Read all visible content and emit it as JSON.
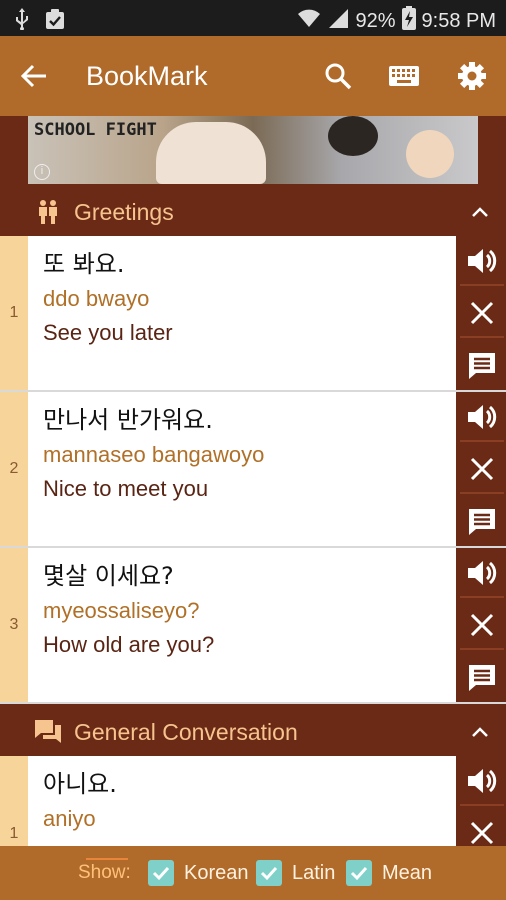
{
  "status_bar": {
    "battery": "92%",
    "time": "9:58 PM"
  },
  "app_bar": {
    "title": "BookMark"
  },
  "banner": {
    "text": "SCHOOL FIGHT",
    "info": "i"
  },
  "sections": [
    {
      "title": "Greetings",
      "items": [
        {
          "num": "1",
          "korean": "또 봐요.",
          "latin": "ddo bwayo",
          "mean": "See you later"
        },
        {
          "num": "2",
          "korean": "만나서 반가워요.",
          "latin": "mannaseo bangawoyo",
          "mean": "Nice to meet you"
        },
        {
          "num": "3",
          "korean": "몇살 이세요?",
          "latin": "myeossaliseyo?",
          "mean": "How old are you?"
        }
      ]
    },
    {
      "title": "General Conversation",
      "items": [
        {
          "num": "1",
          "korean": "아니요.",
          "latin": "aniyo",
          "mean": ""
        }
      ]
    }
  ],
  "bottom_bar": {
    "show_label": "Show:",
    "options": [
      {
        "label": "Korean",
        "checked": true
      },
      {
        "label": "Latin",
        "checked": true
      },
      {
        "label": "Mean",
        "checked": true
      }
    ]
  },
  "colors": {
    "brown": "#6b2a16",
    "orange": "#b06a2a",
    "latin_text": "#b07028",
    "check": "#7fd0c8"
  }
}
